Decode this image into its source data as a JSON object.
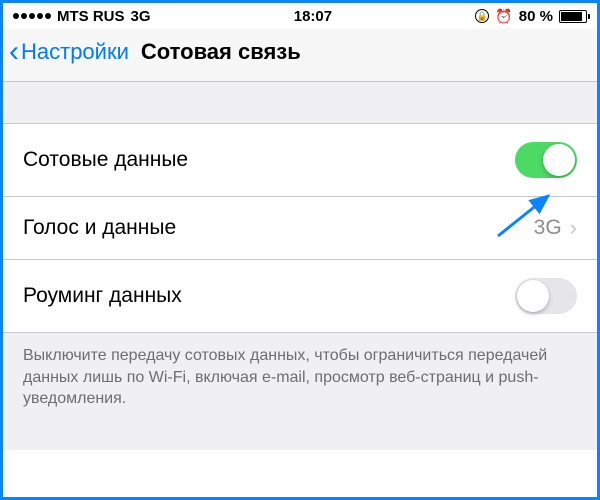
{
  "status_bar": {
    "carrier": "MTS RUS",
    "network": "3G",
    "time": "18:07",
    "battery_pct": "80 %"
  },
  "nav": {
    "back_label": "Настройки",
    "title": "Сотовая связь"
  },
  "rows": {
    "cellular_data": {
      "label": "Сотовые данные",
      "on": true
    },
    "voice_data": {
      "label": "Голос и данные",
      "value": "3G"
    },
    "roaming": {
      "label": "Роуминг данных",
      "on": false
    }
  },
  "footer": "Выключите передачу сотовых данных, чтобы ограничиться передачей данных лишь по Wi-Fi, включая e-mail, просмотр веб-страниц и push-уведомления."
}
